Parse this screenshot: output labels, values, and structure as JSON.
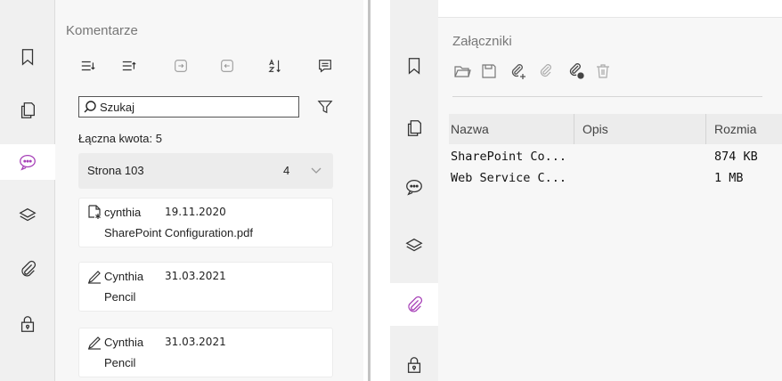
{
  "left_pane": {
    "rail": [
      {
        "icon": "bookmark-icon",
        "active": false
      },
      {
        "icon": "pages-icon",
        "active": false
      },
      {
        "icon": "comment-icon",
        "active": true,
        "accent": "#a63fb7"
      },
      {
        "icon": "layers-icon",
        "active": false
      },
      {
        "icon": "attachment-icon",
        "active": false
      },
      {
        "icon": "lock-icon",
        "active": false
      }
    ],
    "title": "Komentarze",
    "toolbar": [
      "expand-all-icon",
      "collapse-all-icon",
      "next-icon",
      "previous-icon",
      "sort-icon",
      "comment-list-icon"
    ],
    "search": {
      "placeholder": "Szukaj"
    },
    "total_label": "Łączna kwota: 5",
    "page_group": {
      "label": "Strona 103",
      "count": "4"
    },
    "comments": [
      {
        "icon": "file-attachment-icon",
        "author": "cynthia",
        "date": "19.11.2020",
        "text": "SharePoint Configuration.pdf"
      },
      {
        "icon": "pencil-icon",
        "author": "Cynthia",
        "date": "31.03.2021",
        "text": "Pencil"
      },
      {
        "icon": "pencil-icon",
        "author": "Cynthia",
        "date": "31.03.2021",
        "text": "Pencil"
      }
    ]
  },
  "right_pane": {
    "rail": [
      {
        "icon": "bookmark-icon",
        "active": false
      },
      {
        "icon": "pages-icon",
        "active": false
      },
      {
        "icon": "comment-icon",
        "active": false
      },
      {
        "icon": "layers-icon",
        "active": false
      },
      {
        "icon": "attachment-icon",
        "active": true,
        "accent": "#a63fb7"
      },
      {
        "icon": "lock-icon",
        "active": false
      }
    ],
    "title": "Załączniki",
    "toolbar": [
      "open-folder-icon",
      "save-icon",
      "add-attachment-icon",
      "remove-attachment-icon",
      "attachment-settings-icon",
      "delete-icon"
    ],
    "table": {
      "columns": [
        "Nazwa",
        "Opis",
        "Rozmia"
      ],
      "rows": [
        {
          "name": "SharePoint Co...",
          "description": "",
          "size": "874 KB"
        },
        {
          "name": "Web Service C...",
          "description": "",
          "size": "1 MB"
        }
      ]
    }
  }
}
